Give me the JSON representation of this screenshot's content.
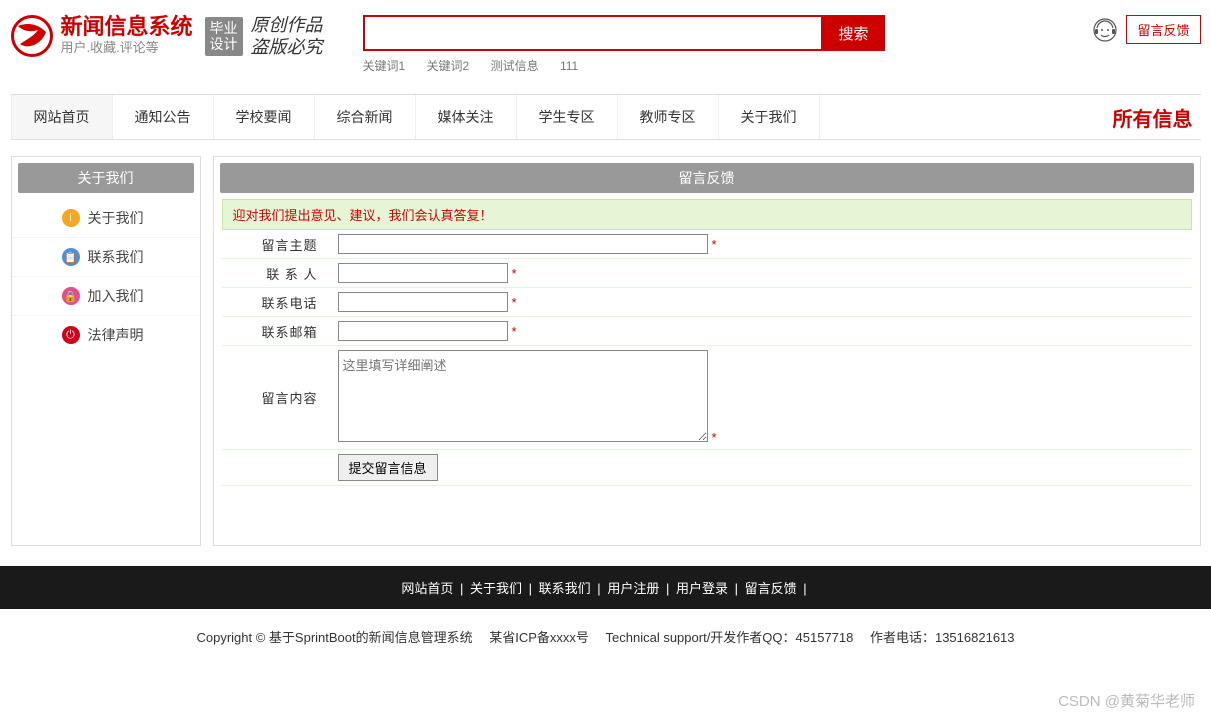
{
  "header": {
    "logo_line1": "新闻信息系统",
    "logo_line2": "用户.收藏.评论等",
    "badge_line1": "毕业",
    "badge_line2": "设计",
    "script_line1": "原创作品",
    "script_line2": "盗版必究",
    "search_placeholder": "",
    "search_button": "搜索",
    "keywords": [
      "关键词1",
      "关键词2",
      "测试信息",
      "111"
    ],
    "feedback_button": "留言反馈"
  },
  "nav": {
    "items": [
      "网站首页",
      "通知公告",
      "学校要闻",
      "综合新闻",
      "媒体关注",
      "学生专区",
      "教师专区",
      "关于我们"
    ],
    "right": "所有信息"
  },
  "sidebar": {
    "title": "关于我们",
    "items": [
      {
        "label": "关于我们",
        "icon": "info"
      },
      {
        "label": "联系我们",
        "icon": "contact"
      },
      {
        "label": "加入我们",
        "icon": "join"
      },
      {
        "label": "法律声明",
        "icon": "legal"
      }
    ]
  },
  "panel": {
    "title": "留言反馈",
    "hint": "迎对我们提出意见、建议，我们会认真答复！",
    "rows": {
      "subject": "留言主题",
      "contact": "联 系 人",
      "phone": "联系电话",
      "email": "联系邮箱",
      "content": "留言内容"
    },
    "textarea_placeholder": "这里填写详细阐述",
    "submit": "提交留言信息"
  },
  "footer": {
    "links": [
      "网站首页",
      "关于我们",
      "联系我们",
      "用户注册",
      "用户登录",
      "留言反馈"
    ],
    "sep": "|",
    "copyright": "Copyright © 基于SprintBoot的新闻信息管理系统　 某省ICP备xxxx号　 Technical support/开发作者QQ：45157718　 作者电话：13516821613"
  },
  "watermark": "CSDN @黄菊华老师"
}
